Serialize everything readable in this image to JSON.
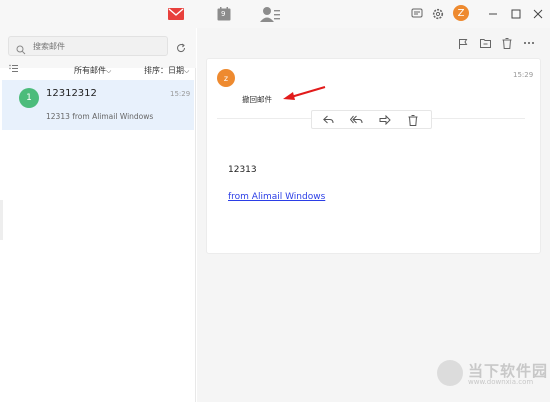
{
  "titlebar": {
    "nav": [
      "mail-icon",
      "calendar-icon",
      "contacts-icon"
    ],
    "calendar_day": "9",
    "user_initial": "Z",
    "accent": "#e8403c"
  },
  "mail_list": {
    "search_placeholder": "搜索邮件",
    "filter_label": "所有邮件",
    "sort_label": "排序：日期",
    "items": [
      {
        "badge": "1",
        "sender": "12312312",
        "time": "15:29",
        "preview": "12313 from Alimail Windows"
      }
    ]
  },
  "reader": {
    "sender_initial": "z",
    "time": "15:29",
    "subject": "撤回邮件",
    "body_text": "12313",
    "body_link": "from Alimail Windows",
    "actions": [
      "reply-icon",
      "reply-all-icon",
      "forward-icon",
      "delete-icon"
    ]
  },
  "watermark": {
    "brand": "当下软件园",
    "url": "www.downxia.com"
  }
}
